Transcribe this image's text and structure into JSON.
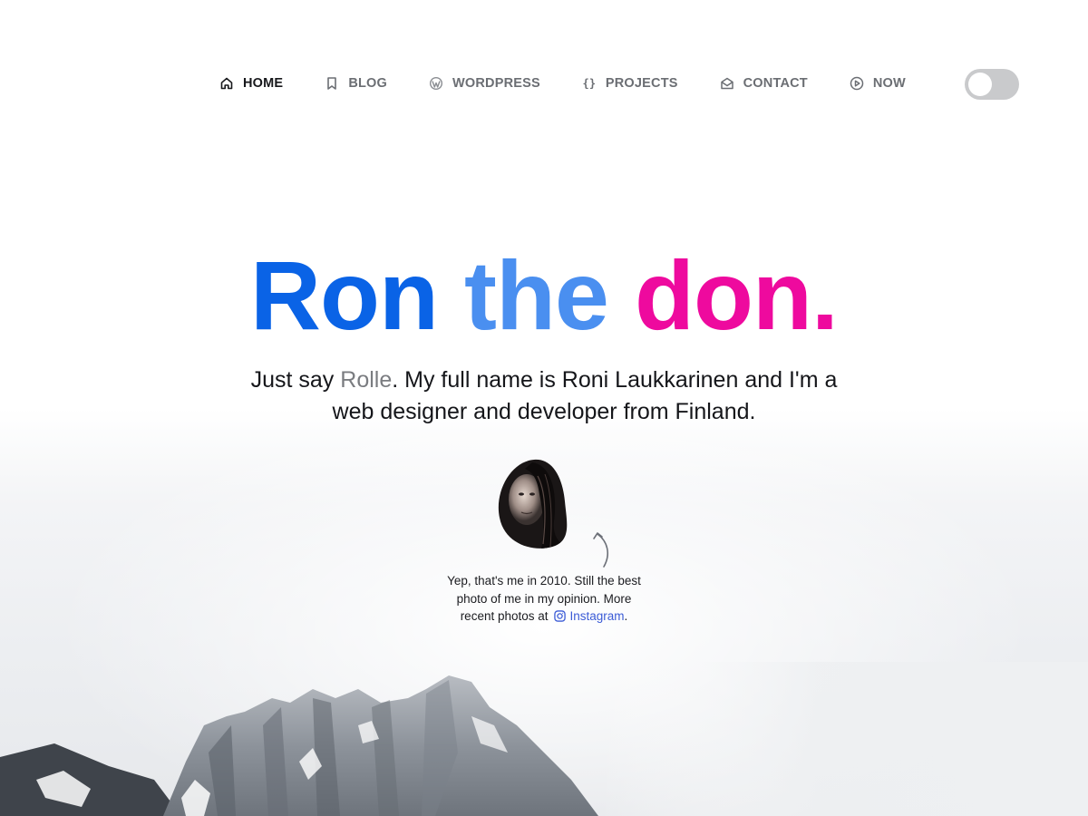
{
  "nav": {
    "items": [
      {
        "label": "HOME",
        "icon": "home-icon",
        "active": true
      },
      {
        "label": "BLOG",
        "icon": "bookmark-icon",
        "active": false
      },
      {
        "label": "WORDPRESS",
        "icon": "wordpress-icon",
        "active": false
      },
      {
        "label": "PROJECTS",
        "icon": "braces-icon",
        "active": false
      },
      {
        "label": "CONTACT",
        "icon": "envelope-open-icon",
        "active": false
      },
      {
        "label": "NOW",
        "icon": "play-circle-icon",
        "active": false
      }
    ],
    "braces_glyph": "{}"
  },
  "theme_toggle": {
    "state": "off"
  },
  "hero": {
    "title_word_1": "Ron",
    "title_word_2": "the",
    "title_word_3": "don.",
    "intro_prefix": "Just say ",
    "intro_nick": "Rolle",
    "intro_line_1_rest": ". My full name is Roni Laukkarinen and I'm a",
    "intro_line_2": "web designer and developer from Finland."
  },
  "caption": {
    "line_1": "Yep, that's me in 2010. Still the best",
    "line_2": "photo of me in my opinion. More",
    "line_3_prefix": "recent photos at",
    "instagram_label": "Instagram",
    "line_3_suffix": "."
  },
  "colors": {
    "title_word_1": "#0a63e6",
    "title_word_2": "#4a8ff0",
    "title_word_3": "#ee0a9e",
    "link": "#3b5bd6",
    "nav_active": "#17181b",
    "nav_inactive": "#6b6e73",
    "toggle_track": "#c9cacc"
  }
}
